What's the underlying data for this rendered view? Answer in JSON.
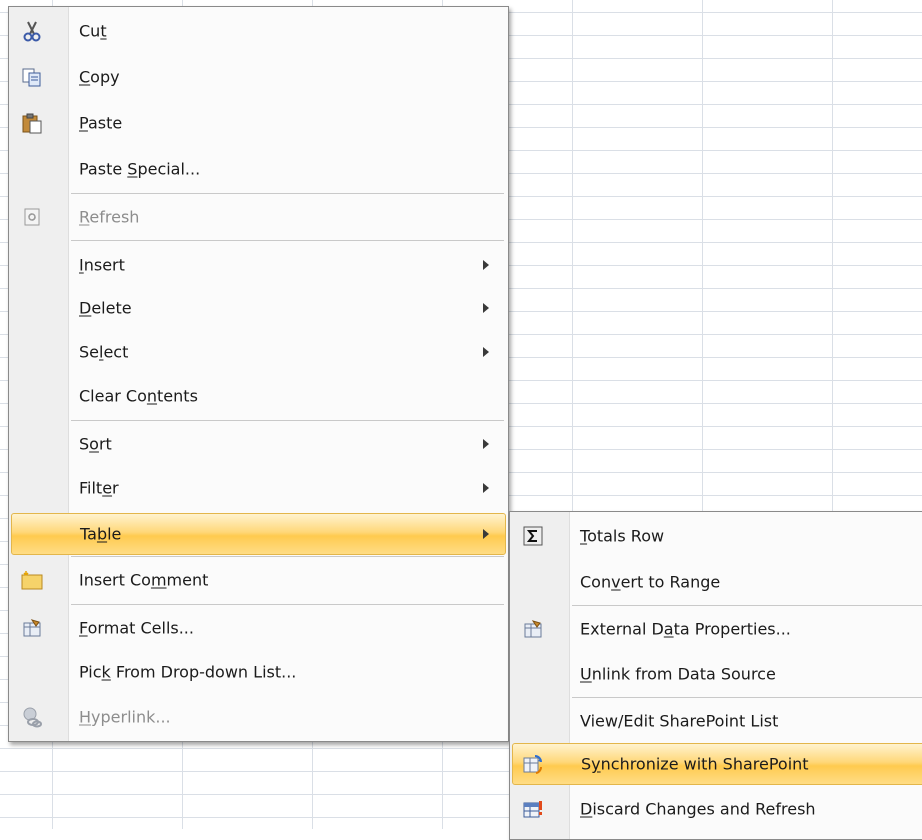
{
  "main_menu": {
    "items": [
      {
        "label_pre": "Cu",
        "label_key": "t",
        "label_post": "",
        "icon": "scissors-icon"
      },
      {
        "label_pre": "",
        "label_key": "C",
        "label_post": "opy",
        "icon": "copy-icon"
      },
      {
        "label_pre": "",
        "label_key": "P",
        "label_post": "aste",
        "icon": "paste-icon"
      },
      {
        "label_pre": "Paste ",
        "label_key": "S",
        "label_post": "pecial...",
        "icon": ""
      },
      {
        "label_pre": "",
        "label_key": "R",
        "label_post": "efresh",
        "icon": "refresh-icon"
      },
      {
        "label_pre": "",
        "label_key": "I",
        "label_post": "nsert",
        "icon": ""
      },
      {
        "label_pre": "",
        "label_key": "D",
        "label_post": "elete",
        "icon": ""
      },
      {
        "label_pre": "Se",
        "label_key": "l",
        "label_post": "ect",
        "icon": ""
      },
      {
        "label_pre": "Clear Co",
        "label_key": "n",
        "label_post": "tents",
        "icon": ""
      },
      {
        "label_pre": "S",
        "label_key": "o",
        "label_post": "rt",
        "icon": ""
      },
      {
        "label_pre": "Filt",
        "label_key": "e",
        "label_post": "r",
        "icon": ""
      },
      {
        "label_pre": "Ta",
        "label_key": "b",
        "label_post": "le",
        "icon": ""
      },
      {
        "label_pre": "Insert Co",
        "label_key": "m",
        "label_post": "ment",
        "icon": "comment-icon"
      },
      {
        "label_pre": "",
        "label_key": "F",
        "label_post": "ormat Cells...",
        "icon": "format-cells-icon"
      },
      {
        "label_pre": "Pic",
        "label_key": "k",
        "label_post": " From Drop-down List...",
        "icon": ""
      },
      {
        "label_pre": "",
        "label_key": "H",
        "label_post": "yperlink...",
        "icon": "hyperlink-icon"
      }
    ]
  },
  "sub_menu": {
    "items": [
      {
        "label_pre": "",
        "label_key": "T",
        "label_post": "otals Row",
        "icon": "sigma-icon"
      },
      {
        "label_pre": "Con",
        "label_key": "v",
        "label_post": "ert to Range",
        "icon": ""
      },
      {
        "label_pre": "External D",
        "label_key": "a",
        "label_post": "ta Properties...",
        "icon": "properties-icon"
      },
      {
        "label_pre": "",
        "label_key": "U",
        "label_post": "nlink from Data Source",
        "icon": ""
      },
      {
        "label_pre": "View/Edit SharePoint List",
        "label_key": "",
        "label_post": "",
        "icon": ""
      },
      {
        "label_pre": "S",
        "label_key": "y",
        "label_post": "nchronize with SharePoint",
        "icon": "sync-icon"
      },
      {
        "label_pre": "",
        "label_key": "D",
        "label_post": "iscard Changes and Refresh",
        "icon": "discard-icon"
      }
    ]
  },
  "colors": {
    "highlight": "#ffd87a",
    "gutter": "#efefef",
    "disabled_text": "#8d8d8d"
  }
}
